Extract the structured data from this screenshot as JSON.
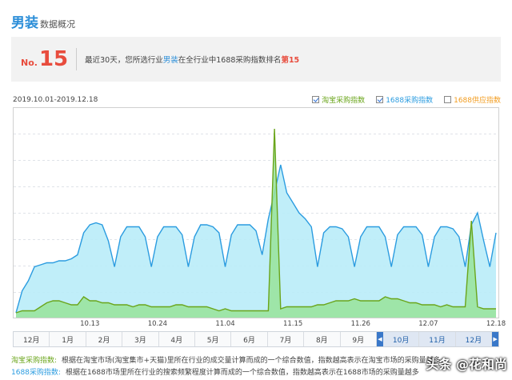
{
  "header": {
    "title_main": "男装",
    "title_sub": "数据概况"
  },
  "rank": {
    "prefix": "No.",
    "number": "15",
    "text_before": "最近30天，您所选行业",
    "category": "男装",
    "text_middle": "在全行业中1688采购指数排名",
    "rank_text": "第15"
  },
  "date_range": "2019.10.01-2019.12.18",
  "legend": [
    {
      "label": "淘宝采购指数",
      "checked": true,
      "color": "#6aa51a"
    },
    {
      "label": "1688采购指数",
      "checked": true,
      "color": "#2b9ce0"
    },
    {
      "label": "1688供应指数",
      "checked": false,
      "color": "#f29c1f"
    }
  ],
  "x_ticks": [
    "10.13",
    "10.24",
    "11.04",
    "11.15",
    "11.26",
    "12.07",
    "12.18"
  ],
  "nav": {
    "months": [
      "12月",
      "1月",
      "2月",
      "3月",
      "4月",
      "5月",
      "6月",
      "7月",
      "8月",
      "9月",
      "10月",
      "11月",
      "12月"
    ],
    "selected_from": 10
  },
  "chart_data": {
    "type": "area",
    "x": [
      "10.01",
      "10.02",
      "10.03",
      "10.04",
      "10.05",
      "10.06",
      "10.07",
      "10.08",
      "10.09",
      "10.10",
      "10.11",
      "10.12",
      "10.13",
      "10.14",
      "10.15",
      "10.16",
      "10.17",
      "10.18",
      "10.19",
      "10.20",
      "10.21",
      "10.22",
      "10.23",
      "10.24",
      "10.25",
      "10.26",
      "10.27",
      "10.28",
      "10.29",
      "10.30",
      "10.31",
      "11.01",
      "11.02",
      "11.03",
      "11.04",
      "11.05",
      "11.06",
      "11.07",
      "11.08",
      "11.09",
      "11.10",
      "11.11",
      "11.12",
      "11.13",
      "11.14",
      "11.15",
      "11.16",
      "11.17",
      "11.18",
      "11.19",
      "11.20",
      "11.21",
      "11.22",
      "11.23",
      "11.24",
      "11.25",
      "11.26",
      "11.27",
      "11.28",
      "11.29",
      "11.30",
      "12.01",
      "12.02",
      "12.03",
      "12.04",
      "12.05",
      "12.06",
      "12.07",
      "12.08",
      "12.09",
      "12.10",
      "12.11",
      "12.12",
      "12.13",
      "12.14",
      "12.15",
      "12.16",
      "12.17",
      "12.18"
    ],
    "series": [
      {
        "name": "1688采购指数",
        "color": "#2b9ce0",
        "values": [
          2,
          13,
          18,
          25,
          26,
          27,
          27,
          28,
          28,
          29,
          31,
          42,
          46,
          47,
          46,
          38,
          25,
          40,
          45,
          45,
          45,
          40,
          25,
          40,
          45,
          45,
          45,
          41,
          25,
          40,
          46,
          46,
          45,
          42,
          25,
          41,
          46,
          46,
          46,
          43,
          31,
          49,
          62,
          76,
          62,
          57,
          52,
          49,
          45,
          25,
          42,
          45,
          45,
          44,
          40,
          25,
          40,
          45,
          45,
          45,
          40,
          25,
          41,
          45,
          45,
          45,
          41,
          25,
          40,
          45,
          45,
          44,
          40,
          25,
          46,
          52,
          38,
          25,
          42
        ]
      },
      {
        "name": "淘宝采购指数",
        "color": "#6aa51a",
        "values": [
          2,
          3,
          3,
          3,
          5,
          7,
          8,
          8,
          7,
          6,
          6,
          10,
          8,
          8,
          7,
          7,
          6,
          6,
          6,
          5,
          6,
          6,
          5,
          5,
          5,
          5,
          6,
          6,
          5,
          5,
          5,
          5,
          4,
          3,
          4,
          3,
          3,
          3,
          3,
          3,
          3,
          3,
          94,
          4,
          5,
          5,
          5,
          5,
          5,
          6,
          6,
          7,
          8,
          8,
          8,
          9,
          8,
          8,
          8,
          8,
          10,
          9,
          9,
          8,
          7,
          7,
          6,
          6,
          6,
          5,
          6,
          5,
          5,
          5,
          48,
          5,
          4,
          4,
          4
        ]
      }
    ],
    "ylim": [
      0,
      100
    ],
    "grid": true
  },
  "notes": [
    {
      "label": "淘宝采购指数:",
      "text": "根据在淘宝市场(淘宝集市+天猫)里所在行业的成交量计算而成的一个综合数值，指数越高表示在淘宝市场的采购量越多"
    },
    {
      "label": "1688采购指数:",
      "text": "根据在1688市场里所在行业的搜索频繁程度计算而成的一个综合数值，指数越高表示在1688市场的采购量越多"
    }
  ],
  "watermark": "头条 @花和尚"
}
